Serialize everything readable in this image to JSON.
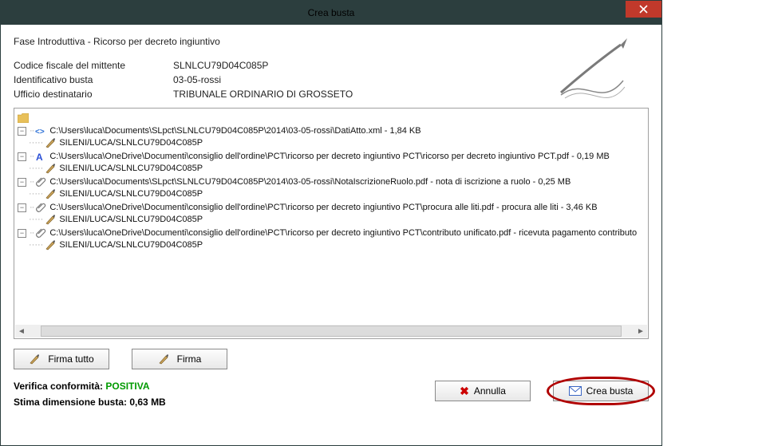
{
  "title": "Crea busta",
  "phase": "Fase Introduttiva - Ricorso per decreto ingiuntivo",
  "info": {
    "cf_label": "Codice fiscale del mittente",
    "cf_value": "SLNLCU79D04C085P",
    "id_label": "Identificativo busta",
    "id_value": "03-05-rossi",
    "office_label": "Ufficio destinatario",
    "office_value": "TRIBUNALE ORDINARIO DI GROSSETO"
  },
  "tree": {
    "signer": "SILENI/LUCA/SLNLCU79D04C085P",
    "items": [
      {
        "icon": "xml",
        "path": "C:\\Users\\luca\\Documents\\SLpct\\SLNLCU79D04C085P\\2014\\03-05-rossi\\DatiAtto.xml - 1,84 KB"
      },
      {
        "icon": "pdfA",
        "path": "C:\\Users\\luca\\OneDrive\\Documenti\\consiglio dell'ordine\\PCT\\ricorso per decreto ingiuntivo PCT\\ricorso per decreto ingiuntivo PCT.pdf - 0,19 MB"
      },
      {
        "icon": "clip",
        "path": "C:\\Users\\luca\\Documents\\SLpct\\SLNLCU79D04C085P\\2014\\03-05-rossi\\NotaIscrizioneRuolo.pdf - nota di iscrizione a ruolo - 0,25 MB"
      },
      {
        "icon": "clip",
        "path": "C:\\Users\\luca\\OneDrive\\Documenti\\consiglio dell'ordine\\PCT\\ricorso per decreto ingiuntivo PCT\\procura alle liti.pdf - procura alle liti - 3,46 KB"
      },
      {
        "icon": "clip",
        "path": "C:\\Users\\luca\\OneDrive\\Documenti\\consiglio dell'ordine\\PCT\\ricorso per decreto ingiuntivo PCT\\contributo unificato.pdf - ricevuta pagamento contributo"
      }
    ]
  },
  "buttons": {
    "sign_all": "Firma tutto",
    "sign": "Firma",
    "cancel": "Annulla",
    "create": "Crea busta"
  },
  "verify": {
    "label": "Verifica conformità:",
    "result": "POSITIVA",
    "size_label": "Stima dimensione busta:",
    "size_value": "0,63 MB"
  }
}
